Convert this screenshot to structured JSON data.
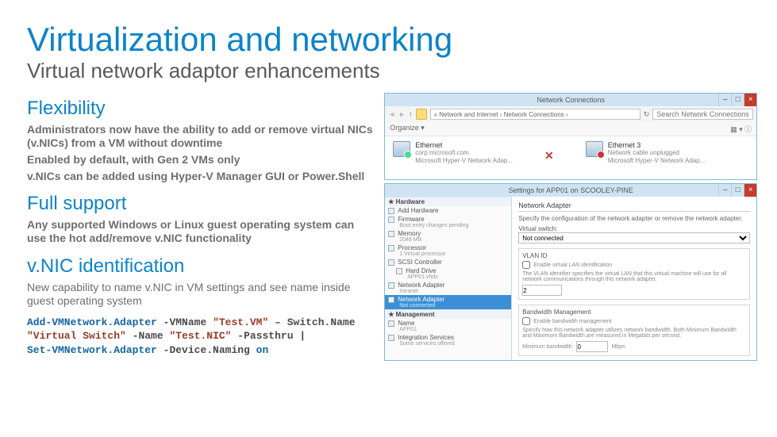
{
  "title": "Virtualization and networking",
  "subtitle": "Virtual network adaptor enhancements",
  "sections": {
    "flex": {
      "heading": "Flexibility",
      "p1": "Administrators now have the ability to add or remove virtual NICs (v.NICs) from a VM without downtime",
      "p2": "Enabled by default, with Gen 2 VMs only",
      "p3": "v.NICs can be added using Hyper-V Manager GUI or Power.Shell"
    },
    "full": {
      "heading": "Full support",
      "p1": "Any supported Windows or Linux guest operating system can use the hot add/remove v.NIC functionality"
    },
    "vnic": {
      "heading": "v.NIC identification",
      "p1": "New capability to name v.NIC in VM settings and see name inside guest operating system"
    }
  },
  "code": {
    "cmd1": "Add-VMNetwork.Adapter",
    "p_vmname": "-VMName",
    "s_testvm": "\"Test.VM\"",
    "dash": "–",
    "p_switch": "Switch.Name",
    "s_vswitch": "\"Virtual Switch\"",
    "p_name": "-Name",
    "s_testnic": "\"Test.NIC\"",
    "p_passthru": "-Passthru",
    "pipe": "|",
    "cmd2": "Set-VMNetwork.Adapter",
    "p_devname": "-Device.Naming",
    "v_on": "on"
  },
  "nc": {
    "title": "Network Connections",
    "crumb": "«  Network and Internet  ›  Network Connections  ›",
    "search_ph": "Search Network Connections",
    "organize": "Organize ▾",
    "eth1": {
      "name": "Ethernet",
      "line2": "corp.microsoft.com",
      "line3": "Microsoft Hyper-V Network Adap..."
    },
    "eth3": {
      "name": "Ethernet 3",
      "line2": "Network cable unplugged",
      "line3": "Microsoft Hyper-V Network Adap..."
    }
  },
  "settings": {
    "title": "Settings for APP01 on SCOOLEY-PINE",
    "hw": "Hardware",
    "addhw": "Add Hardware",
    "fw": "Firmware",
    "fw_sub": "Boot entry changes pending",
    "mem": "Memory",
    "mem_sub": "2048 MB",
    "proc": "Processor",
    "proc_sub": "1 Virtual processor",
    "scsi": "SCSI Controller",
    "hdd": "Hard Drive",
    "hdd_sub": "APP01.vhdx",
    "na1": "Network Adapter",
    "na1_sub": "Intranet",
    "na2": "Network Adapter",
    "na2_sub": "Not connected",
    "mgmt": "Management",
    "name": "Name",
    "name_sub": "APP01",
    "intsvc": "Integration Services",
    "intsvc_sub": "Some services offered",
    "form": {
      "hdr": "Network Adapter",
      "desc": "Specify the configuration of the network adapter or remove the network adapter.",
      "vsw": "Virtual switch:",
      "vsw_val": "Not connected",
      "vlan_h": "VLAN ID",
      "vlan_chk": "Enable virtual LAN identification",
      "vlan_txt": "The VLAN identifier specifies the virtual LAN that this virtual machine will use for all network communications through this network adapter.",
      "vlan_val": "2",
      "bw_h": "Bandwidth Management",
      "bw_chk": "Enable bandwidth management",
      "bw_txt": "Specify how this network adapter utilizes network bandwidth. Both Minimum Bandwidth and Maximum Bandwidth are measured in Megabits per second.",
      "bw_min": "Minimum bandwidth:",
      "bw_min_v": "0",
      "bw_unit": "Mbps"
    }
  }
}
